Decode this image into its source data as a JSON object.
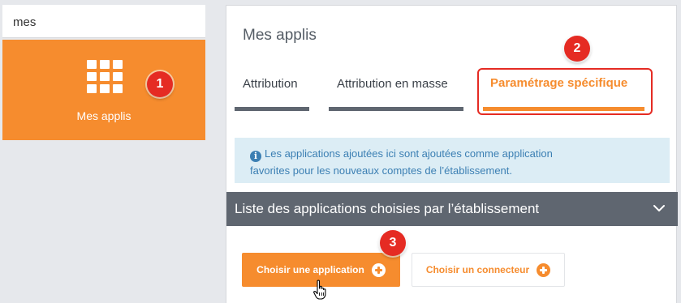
{
  "search": {
    "value": "mes"
  },
  "tile": {
    "label": "Mes applis",
    "icon": "grid-apps-icon"
  },
  "panel": {
    "title": "Mes applis",
    "tabs": [
      {
        "label": "Attribution",
        "active": false
      },
      {
        "label": "Attribution en masse",
        "active": false
      },
      {
        "label": "Paramétrage spécifique",
        "active": true
      }
    ],
    "info": {
      "icon": "info-icon",
      "glyph": "i",
      "line1": "Les applications ajoutées ici sont ajoutées comme application",
      "line2": "favorites pour les nouveaux comptes de l’établissement."
    },
    "section": {
      "title": "Liste des applications choisies par l’établissement",
      "icon": "chevron-down-icon"
    },
    "buttons": {
      "choose_app": "Choisir une application",
      "choose_connector": "Choisir un connecteur"
    }
  },
  "callouts": [
    "1",
    "2",
    "3"
  ],
  "colors": {
    "accent": "#f68c2e",
    "dark": "#5f6670",
    "callout": "#e52b23",
    "info_bg": "#dcedf5",
    "info_text": "#3b7fb3"
  }
}
